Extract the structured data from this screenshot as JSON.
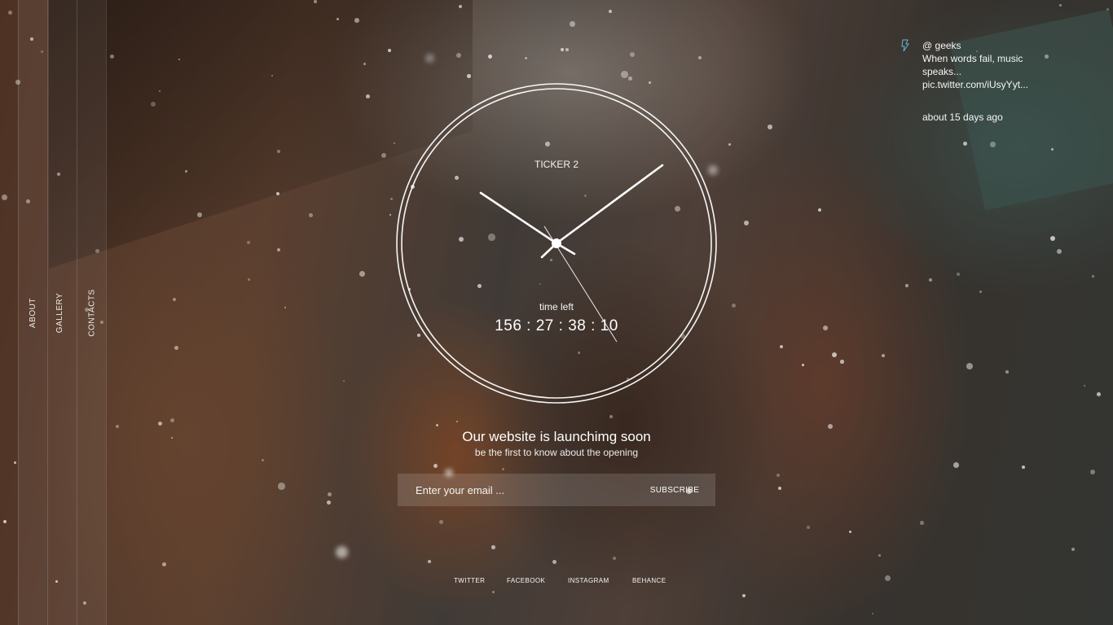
{
  "nav": {
    "items": [
      {
        "label": "ABOUT"
      },
      {
        "label": "GALLERY"
      },
      {
        "label": "CONTACTS"
      }
    ]
  },
  "clock": {
    "ticker_label": "TICKER 2",
    "time_left_label": "time left",
    "countdown": "156 : 27 : 38 : 10"
  },
  "hero": {
    "headline": "Our website is launchimg soon",
    "subline": "be the first to know about the opening"
  },
  "subscribe": {
    "email_placeholder": "Enter your email ...",
    "button_label": "SUBSCRIBE"
  },
  "social": {
    "items": [
      {
        "label": "TWITTER"
      },
      {
        "label": "FACEBOOK"
      },
      {
        "label": "INSTAGRAM"
      },
      {
        "label": "BEHANCE"
      }
    ]
  },
  "tweet": {
    "handle": "@ geeks",
    "text": "When words fail, music speaks...",
    "link": "pic.twitter.com/iUsyYyt...",
    "time": "about 15 days ago"
  },
  "colors": {
    "text": "#ffffff",
    "form_background": "rgba(255,255,255,0.14)",
    "icon_accent": "#5fb8d8"
  },
  "icons": {
    "tweet": "twitter-bird-icon"
  }
}
